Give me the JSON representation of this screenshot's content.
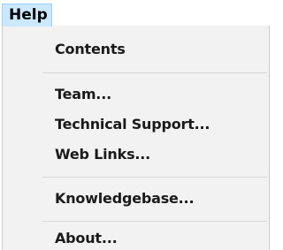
{
  "menu": {
    "title": "Help",
    "items": [
      {
        "label": "Contents"
      },
      {
        "label": "Team..."
      },
      {
        "label": "Technical Support..."
      },
      {
        "label": "Web Links..."
      },
      {
        "label": "Knowledgebase..."
      },
      {
        "label": "About..."
      }
    ]
  },
  "colors": {
    "menu_title_highlight": "#cce8ff",
    "menu_title_border": "#99d1ff",
    "panel_background": "#f2f2f2",
    "separator": "#d7d7d7"
  }
}
